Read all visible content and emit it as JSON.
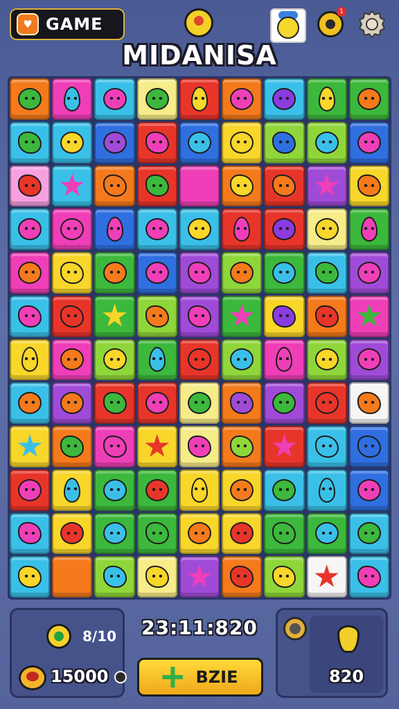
{
  "header": {
    "game_label": "GAME",
    "game_logo_glyph": "♥",
    "title": "MIDANISA",
    "notification_count": "1"
  },
  "icons": {
    "game_logo": "game-logo-icon",
    "hint": "lightbulb-icon",
    "avatar": "character-avatar-icon",
    "coin": "coin-icon",
    "settings": "gear-icon"
  },
  "colors": {
    "red": "#e8352a",
    "orange": "#f47a1c",
    "yellow": "#f8d62a",
    "lightyellow": "#f7ec8a",
    "green": "#3cb83c",
    "lime": "#8fd63a",
    "cyan": "#3ac0e8",
    "blue": "#2f6fe0",
    "purple": "#8a3ce0",
    "pink": "#ef3fb8",
    "lightpink": "#f6a0e0",
    "white": "#f6f6f6",
    "violet": "#a04bd8"
  },
  "board": {
    "rows": [
      [
        [
          "orange",
          "green"
        ],
        [
          "pink",
          "cyan"
        ],
        [
          "cyan",
          "pink"
        ],
        [
          "lightyellow",
          "green"
        ],
        [
          "red",
          "yellow"
        ],
        [
          "orange",
          "pink"
        ],
        [
          "cyan",
          "purple"
        ],
        [
          "green",
          "yellow"
        ],
        [
          "green",
          "orange"
        ]
      ],
      [
        [
          "cyan",
          "green"
        ],
        [
          "cyan",
          "yellow"
        ],
        [
          "blue",
          "violet"
        ],
        [
          "red",
          "pink"
        ],
        [
          "blue",
          "cyan"
        ],
        [
          "yellow",
          "yellow"
        ],
        [
          "lime",
          "blue"
        ],
        [
          "lime",
          "cyan"
        ],
        [
          "blue",
          "pink"
        ]
      ],
      [
        [
          "lightpink",
          "red"
        ],
        [
          "cyan",
          "pink"
        ],
        [
          "orange",
          "orange"
        ],
        [
          "red",
          "green"
        ],
        [
          "pink",
          "pink"
        ],
        [
          "orange",
          "yellow"
        ],
        [
          "red",
          "orange"
        ],
        [
          "violet",
          "pink"
        ],
        [
          "yellow",
          "orange"
        ]
      ],
      [
        [
          "cyan",
          "pink"
        ],
        [
          "pink",
          "pink"
        ],
        [
          "blue",
          "pink"
        ],
        [
          "cyan",
          "pink"
        ],
        [
          "cyan",
          "yellow"
        ],
        [
          "red",
          "pink"
        ],
        [
          "red",
          "purple"
        ],
        [
          "lightyellow",
          "yellow"
        ],
        [
          "green",
          "pink"
        ]
      ],
      [
        [
          "pink",
          "orange"
        ],
        [
          "yellow",
          "yellow"
        ],
        [
          "green",
          "orange"
        ],
        [
          "blue",
          "pink"
        ],
        [
          "violet",
          "pink"
        ],
        [
          "lime",
          "orange"
        ],
        [
          "green",
          "cyan"
        ],
        [
          "cyan",
          "green"
        ],
        [
          "violet",
          "pink"
        ]
      ],
      [
        [
          "cyan",
          "pink"
        ],
        [
          "red",
          "red"
        ],
        [
          "green",
          "yellow"
        ],
        [
          "lime",
          "orange"
        ],
        [
          "violet",
          "pink"
        ],
        [
          "green",
          "pink"
        ],
        [
          "yellow",
          "purple"
        ],
        [
          "orange",
          "red"
        ],
        [
          "pink",
          "green"
        ]
      ],
      [
        [
          "yellow",
          "yellow"
        ],
        [
          "pink",
          "orange"
        ],
        [
          "lime",
          "yellow"
        ],
        [
          "green",
          "cyan"
        ],
        [
          "red",
          "red"
        ],
        [
          "lime",
          "cyan"
        ],
        [
          "pink",
          "pink"
        ],
        [
          "lime",
          "yellow"
        ],
        [
          "violet",
          "pink"
        ]
      ],
      [
        [
          "cyan",
          "orange"
        ],
        [
          "violet",
          "orange"
        ],
        [
          "red",
          "green"
        ],
        [
          "red",
          "pink"
        ],
        [
          "lightyellow",
          "green"
        ],
        [
          "orange",
          "violet"
        ],
        [
          "violet",
          "green"
        ],
        [
          "red",
          "red"
        ],
        [
          "white",
          "orange"
        ]
      ],
      [
        [
          "yellow",
          "cyan"
        ],
        [
          "orange",
          "green"
        ],
        [
          "pink",
          "pink"
        ],
        [
          "yellow",
          "red"
        ],
        [
          "lightyellow",
          "pink"
        ],
        [
          "orange",
          "lime"
        ],
        [
          "red",
          "pink"
        ],
        [
          "cyan",
          "cyan"
        ],
        [
          "blue",
          "blue"
        ]
      ],
      [
        [
          "red",
          "pink"
        ],
        [
          "yellow",
          "cyan"
        ],
        [
          "green",
          "cyan"
        ],
        [
          "green",
          "red"
        ],
        [
          "yellow",
          "yellow"
        ],
        [
          "yellow",
          "orange"
        ],
        [
          "cyan",
          "green"
        ],
        [
          "cyan",
          "cyan"
        ],
        [
          "blue",
          "pink"
        ]
      ],
      [
        [
          "cyan",
          "pink"
        ],
        [
          "yellow",
          "red"
        ],
        [
          "green",
          "cyan"
        ],
        [
          "green",
          "green"
        ],
        [
          "yellow",
          "orange"
        ],
        [
          "yellow",
          "red"
        ],
        [
          "green",
          "green"
        ],
        [
          "green",
          "cyan"
        ],
        [
          "cyan",
          "green"
        ]
      ],
      [
        [
          "cyan",
          "yellow"
        ],
        [
          "orange",
          "orange"
        ],
        [
          "lime",
          "cyan"
        ],
        [
          "lightyellow",
          "yellow"
        ],
        [
          "violet",
          "pink"
        ],
        [
          "orange",
          "red"
        ],
        [
          "lime",
          "yellow"
        ],
        [
          "white",
          "red"
        ],
        [
          "cyan",
          "pink"
        ]
      ]
    ]
  },
  "footer": {
    "moves": "8/10",
    "coins": "15000",
    "timer": "23:11:820",
    "boost_label": "BZIE",
    "target_count": "820"
  }
}
